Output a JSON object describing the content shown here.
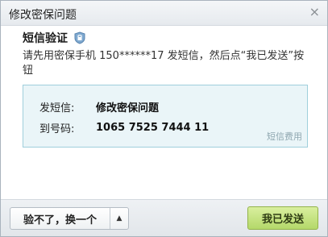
{
  "dialog": {
    "title": "修改密保问题",
    "close_glyph": "×"
  },
  "content": {
    "heading": "短信验证",
    "shield_icon": "shield-icon",
    "instruction": "请先用密保手机 150******17 发短信，然后点“我已发送”按钮"
  },
  "sms_info": {
    "send_label": "发短信:",
    "send_value": "修改密保问题",
    "to_label": "到号码:",
    "to_value": "1065 7525 7444 11",
    "fee_link": "短信费用"
  },
  "footer": {
    "alt_button_label": "验不了，换一个",
    "alt_button_arrow": "▲",
    "send_button_label": "我已发送"
  },
  "colors": {
    "accent_green": "#b4d86a",
    "info_box_bg": "#eaf5f8",
    "info_box_border": "#9fcfdc"
  }
}
